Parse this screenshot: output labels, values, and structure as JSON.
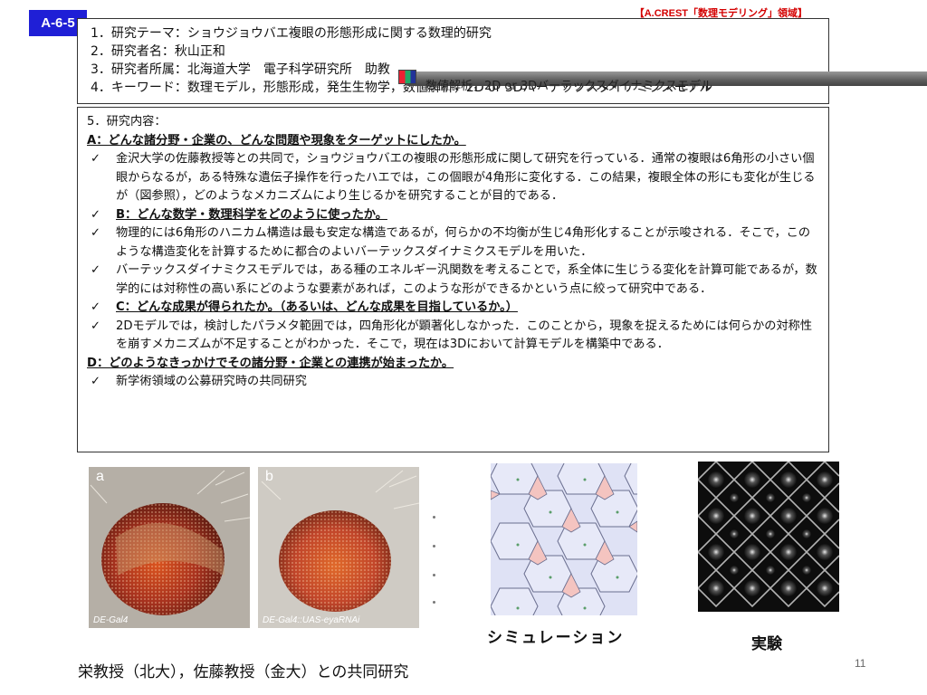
{
  "badge": "A-6-5",
  "tagline": "【A.CREST「数理モデリング」領域】",
  "header": {
    "line1": "1．研究テーマ：ショウジョウバエ複眼の形態形成に関する数理的研究",
    "line2": "2．研究者名：秋山正和",
    "line3": "3．研究者所属：北海道大学　電子科学研究所　助教",
    "line4": "4．キーワード：数理モデル，形態形成，発生生物学，数値解析，2D or 3Dバーテックスダイナミクスモデル"
  },
  "overlay_text": "数値解析，2D or 3Dバーテックスダイナミクスモデル",
  "content": {
    "sec5_title": "5．研究内容",
    "sec5_colon": "：",
    "heading_a": "A：どんな諸分野・企業の、どんな問題や現象をターゲットにしたか。",
    "check": "✓",
    "item_a1": "金沢大学の佐藤教授等との共同で，ショウジョウバエの複眼の形態形成に関して研究を行っている．通常の複眼は6角形の小さい個眼からなるが，ある特殊な遺伝子操作を行ったハエでは，この個眼が4角形に変化する．この結果，複眼全体の形にも変化が生じるが（図参照），どのようなメカニズムにより生じるかを研究することが目的である．",
    "heading_b": "B：どんな数学・数理科学をどのように使ったか。",
    "item_b1": "物理的には6角形のハニカム構造は最も安定な構造であるが，何らかの不均衡が生じ4角形化することが示唆される．そこで，このような構造変化を計算するために都合のよいバーテックスダイナミクスモデルを用いた．",
    "item_b2": "バーテックスダイナミクスモデルでは，ある種のエネルギー汎関数を考えることで，系全体に生じうる変化を計算可能であるが，数学的には対称性の高い系にどのような要素があれば，このような形ができるかという点に絞って研究中である．",
    "heading_c": "C：どんな成果が得られたか。（あるいは、どんな成果を目指しているか。）",
    "item_c1": "2Dモデルでは，検討したパラメタ範囲では，四角形化が顕著化しなかった．このことから，現象を捉えるためには何らかの対称性を崩すメカニズムが不足することがわかった．そこで，現在は3Dにおいて計算モデルを構築中である．",
    "heading_d": "D：どのようなきっかけでその諸分野・企業との連携が始まったか。",
    "item_d1": "新学術領域の公募研究時の共同研究"
  },
  "figures": {
    "photo_a_label": "a",
    "photo_a_caption": "DE-Gal4",
    "photo_b_label": "b",
    "photo_b_caption": "DE-Gal4::UAS-eyaRNAi",
    "simulation_caption": "シミュレーション",
    "experiment_caption": "実験"
  },
  "footer": "栄教授（北大），佐藤教授（金大）との共同研究",
  "page_number": "11",
  "colors": {
    "badge": "#1f1fd6",
    "tagline": "#d40000",
    "eye_red": "#a8321e",
    "sim_cell": "#d8dcf2",
    "sim_pink": "#f4c4c0"
  },
  "icons": {
    "check": "check-mark-icon"
  }
}
